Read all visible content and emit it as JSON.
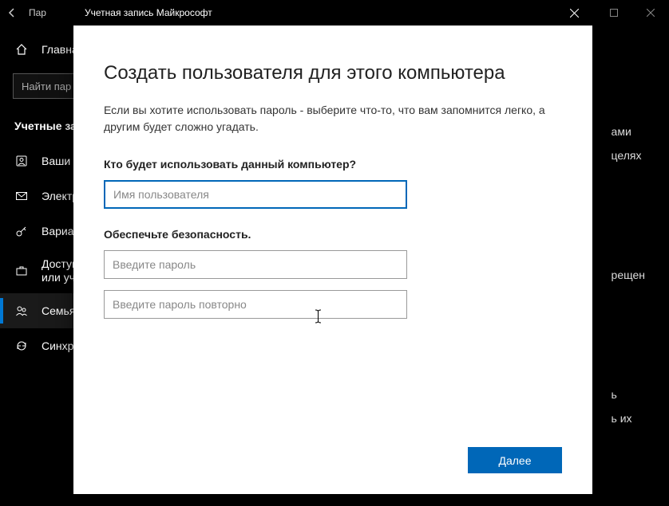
{
  "bgWindow": {
    "titlePartial": "Пар",
    "homeLabel": "Главна",
    "searchPlaceholder": "Найти пар",
    "sectionHeader": "Учетные за",
    "navItems": [
      {
        "label": "Ваши д"
      },
      {
        "label": "Электр"
      },
      {
        "label": "Вариан"
      },
      {
        "label": "Доступ\nили уч"
      },
      {
        "label": "Семья "
      },
      {
        "label": "Синхро"
      }
    ],
    "rightFragments": [
      "ами",
      "целях",
      "",
      "",
      "",
      "",
      "рещен",
      "",
      "",
      "",
      "",
      "ь",
      "ь их"
    ]
  },
  "modal": {
    "title": "Учетная запись Майкрософт",
    "heading": "Создать пользователя для этого компьютера",
    "description": "Если вы хотите использовать пароль - выберите что-то, что вам запомнится легко, а другим будет сложно угадать.",
    "question1": "Кто будет использовать данный компьютер?",
    "usernamePlaceholder": "Имя пользователя",
    "question2": "Обеспечьте безопасность.",
    "passwordPlaceholder": "Введите пароль",
    "passwordRepeatPlaceholder": "Введите пароль повторно",
    "nextButton": "Далее"
  }
}
